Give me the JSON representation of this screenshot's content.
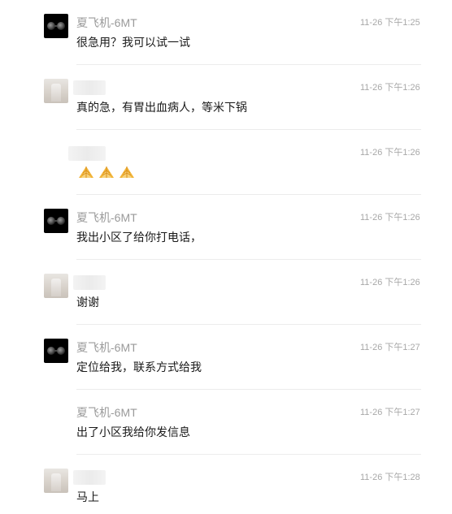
{
  "messages": [
    {
      "sender": "夏飞机-6MT",
      "time": "11-26 下午1:25",
      "text": "很急用？我可以试一试",
      "avatar": "dark"
    },
    {
      "sender": "",
      "time": "11-26 下午1:26",
      "text": "真的急，有胃出血病人，等米下锅",
      "avatar": "photo"
    },
    {
      "sender": "",
      "time": "11-26 下午1:26",
      "text": "",
      "emoji": [
        "rice-icon",
        "rice-icon",
        "rice-icon"
      ],
      "avatar": "none"
    },
    {
      "sender": "夏飞机-6MT",
      "time": "11-26 下午1:26",
      "text": "我出小区了给你打电话，",
      "avatar": "dark"
    },
    {
      "sender": "",
      "time": "11-26 下午1:26",
      "text": "谢谢",
      "avatar": "photo"
    },
    {
      "sender": "夏飞机-6MT",
      "time": "11-26 下午1:27",
      "text": "定位给我，联系方式给我",
      "avatar": "dark"
    },
    {
      "sender": "夏飞机-6MT",
      "time": "11-26 下午1:27",
      "text": "出了小区我给你发信息",
      "avatar": "none"
    },
    {
      "sender": "",
      "time": "11-26 下午1:28",
      "text": "马上",
      "avatar": "photo"
    }
  ],
  "colors": {
    "name": "#9a9a9a",
    "time": "#a8a8a8",
    "text": "#1a1a1a",
    "divider": "#ececec"
  }
}
